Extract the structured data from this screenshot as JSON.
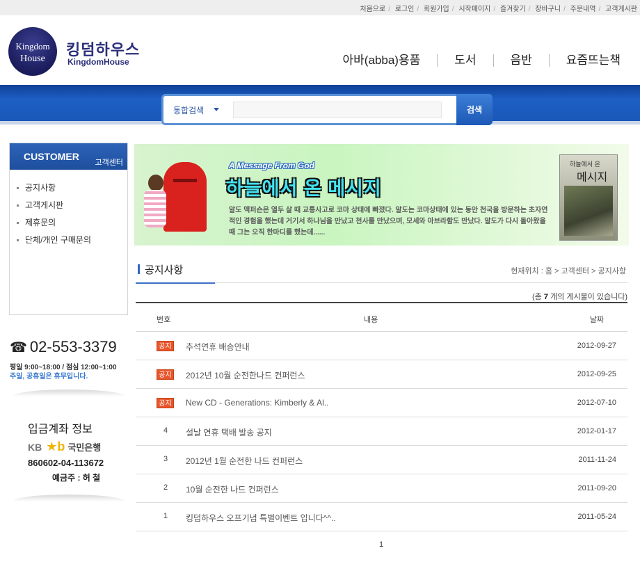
{
  "top_links": [
    "처음으로",
    "로그인",
    "회원가입",
    "시작페이지",
    "즐겨찾기",
    "장바구니",
    "주문내역",
    "고객게시판"
  ],
  "logo": {
    "circle_line1": "Kingdom",
    "circle_line2": "House",
    "text_ko": "킹덤하우스",
    "text_en": "KingdomHouse"
  },
  "main_nav": [
    "아바(abba)용품",
    "도서",
    "음반",
    "요즘뜨는책"
  ],
  "search": {
    "category": "통합검색",
    "button": "검색",
    "value": ""
  },
  "sidebar": {
    "title_en": "CUSTOMER",
    "title_ko": "고객센터",
    "menu": [
      "공지사항",
      "고객게시판",
      "제휴문의",
      "단체/개인 구매문의"
    ],
    "phone": "02-553-3379",
    "hours": "평일 9:00~18:00 / 점심 12:00~1:00",
    "holiday": "주일, 공휴일은 휴무입니다.",
    "bank_title": "입금계좌 정보",
    "bank_kb": "KB",
    "bank_mark": "★b",
    "bank_name": "국민은행",
    "account": "860602-04-113672",
    "holder": "예금주 : 허 철"
  },
  "banner": {
    "subtitle_en": "A Message From God",
    "title": "하늘에서 온 메시지",
    "body": "알도 맥퍼슨은 열두 살 때 교통사고로 코마 상태에 빠졌다. 알도는 코마상태에 있는 동안 천국을 방문하는 초자연적인 경험을 했는데 거기서 하나님을 만났고 천사를 만났으며, 모세와 아브라함도 만났다. 알도가 다시 돌아왔을 때 그는 오직 한마디를 했는데......",
    "book_title_small": "하늘에서 온",
    "book_title_big": "메시지"
  },
  "page": {
    "title": "공지사항",
    "breadcrumb": "현재위치 : 홈 > 고객센터  > 공지사항",
    "count_prefix": "(총 ",
    "count": "7",
    "count_suffix": " 개의 게시물이 있습니다)"
  },
  "table": {
    "headers": {
      "num": "번호",
      "subject": "내용",
      "date": "날짜"
    },
    "notice_label": "공지",
    "rows": [
      {
        "num": "",
        "notice": true,
        "subject": "추석연휴 배송안내",
        "date": "2012-09-27"
      },
      {
        "num": "",
        "notice": true,
        "subject": "2012년 10월 순전한나드 컨퍼런스",
        "date": "2012-09-25"
      },
      {
        "num": "",
        "notice": true,
        "subject": "New CD - Generations: Kimberly & Al..",
        "date": "2012-07-10"
      },
      {
        "num": "4",
        "notice": false,
        "subject": "설날 연휴 택배 발송 공지",
        "date": "2012-01-17"
      },
      {
        "num": "3",
        "notice": false,
        "subject": "2012년 1월 순전한 나드 컨퍼런스",
        "date": "2011-11-24"
      },
      {
        "num": "2",
        "notice": false,
        "subject": " 10월 순전한 나드 컨퍼런스",
        "date": "2011-09-20"
      },
      {
        "num": "1",
        "notice": false,
        "subject": "킹덤하우스 오프기념 특별이벤트 입니다^^..",
        "date": "2011-05-24"
      }
    ]
  },
  "pagination": {
    "current": "1"
  }
}
